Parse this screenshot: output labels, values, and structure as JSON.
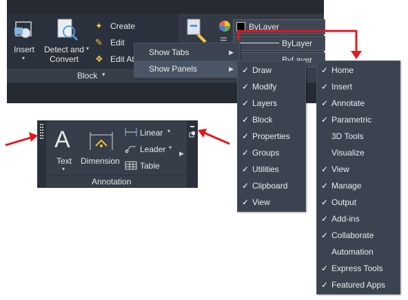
{
  "ribbon": {
    "buttons": {
      "insert": "Insert",
      "detect_and_convert": [
        "Detect and",
        "Convert"
      ],
      "create": "Create",
      "edit": "Edit",
      "edit_attributes": "Edit At"
    },
    "panel_name": "Block",
    "layer_value_1": "ByLayer",
    "layer_value_2": "ByLayer",
    "layer_value_3": "ByLayer"
  },
  "context_menu": {
    "items": [
      {
        "label": "Show Tabs",
        "has_submenu": true
      },
      {
        "label": "Show Panels",
        "has_submenu": true,
        "highlighted": true
      }
    ]
  },
  "panels_submenu": {
    "items": [
      {
        "label": "Draw",
        "checked": true
      },
      {
        "label": "Modify",
        "checked": true
      },
      {
        "label": "Layers",
        "checked": true
      },
      {
        "label": "Block",
        "checked": true
      },
      {
        "label": "Properties",
        "checked": true
      },
      {
        "label": "Groups",
        "checked": true
      },
      {
        "label": "Utilities",
        "checked": true
      },
      {
        "label": "Clipboard",
        "checked": true
      },
      {
        "label": "View",
        "checked": true
      }
    ]
  },
  "tabs_submenu": {
    "items": [
      {
        "label": "Home",
        "checked": true
      },
      {
        "label": "Insert",
        "checked": true
      },
      {
        "label": "Annotate",
        "checked": true
      },
      {
        "label": "Parametric",
        "checked": true
      },
      {
        "label": "3D Tools",
        "checked": false
      },
      {
        "label": "Visualize",
        "checked": false
      },
      {
        "label": "View",
        "checked": true
      },
      {
        "label": "Manage",
        "checked": true
      },
      {
        "label": "Output",
        "checked": true
      },
      {
        "label": "Add-ins",
        "checked": true
      },
      {
        "label": "Collaborate",
        "checked": true
      },
      {
        "label": "Automation",
        "checked": false
      },
      {
        "label": "Express Tools",
        "checked": true
      },
      {
        "label": "Featured Apps",
        "checked": true
      }
    ]
  },
  "annotation_panel": {
    "text_button": "Text",
    "dimension_button": "Dimension",
    "linear": "Linear",
    "leader": "Leader",
    "table": "Table",
    "title": "Annotation"
  },
  "check_glyph": "✓",
  "colors": {
    "ribbon_bg": "#2b313c",
    "menu_bg": "#3c4350",
    "highlight": "#4a5566",
    "arrow_red": "#e8141c"
  }
}
